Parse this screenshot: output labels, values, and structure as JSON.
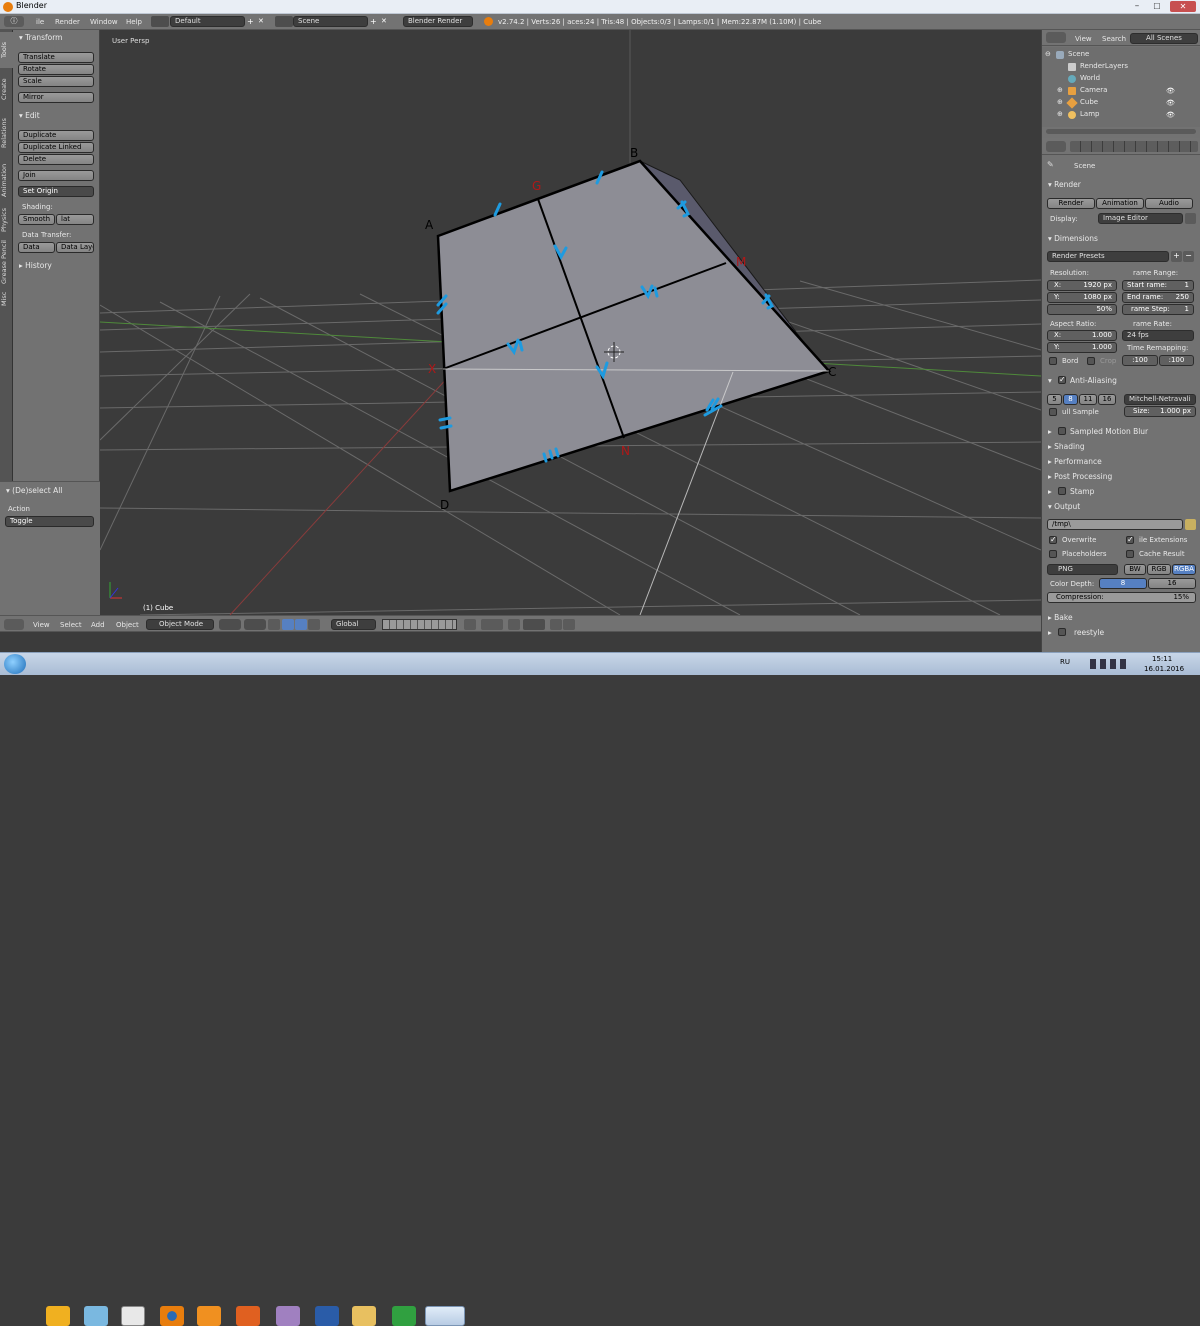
{
  "window": {
    "title": "Blender"
  },
  "top_menu": {
    "items": [
      "ile",
      "Render",
      "Window",
      "Help"
    ],
    "layout": "Default",
    "scene": "Scene",
    "engine": "Blender Render",
    "stats": "v2.74.2 | Verts:26 | aces:24 | Tris:48 | Objects:0/3 | Lamps:0/1 | Mem:22.87M (1.10M) | Cube"
  },
  "left_tabs": [
    "Tools",
    "Create",
    "Relations",
    "Animation",
    "Physics",
    "Grease Pencil",
    "Misc"
  ],
  "tools": {
    "transform_title": "Transform",
    "translate": "Translate",
    "rotate": "Rotate",
    "scale": "Scale",
    "mirror": "Mirror",
    "edit_title": "Edit",
    "duplicate": "Duplicate",
    "duplicate_linked": "Duplicate Linked",
    "delete": "Delete",
    "join": "Join",
    "set_origin": "Set Origin",
    "shading_label": "Shading:",
    "smooth": "Smooth",
    "flat": "lat",
    "data_transfer_label": "Data Transfer:",
    "data": "Data",
    "data_layo": "Data Layo",
    "history_title": "History"
  },
  "operator": {
    "title": "(De)select All",
    "action_label": "Action",
    "action_value": "Toggle"
  },
  "viewport": {
    "view_name": "User Persp",
    "object_label": "(1) Cube",
    "points": [
      "A",
      "B",
      "C",
      "D",
      "G",
      "M",
      "N",
      "X"
    ],
    "marks": [
      "I",
      "I",
      "II",
      "II",
      "II",
      "III",
      "IV",
      "IV",
      "V",
      "V",
      "VI",
      "VI"
    ]
  },
  "bottom_bar": {
    "view": "View",
    "select": "Select",
    "add": "Add",
    "object": "Object",
    "mode": "Object Mode",
    "orientation": "Global"
  },
  "outliner": {
    "tabs": [
      "View",
      "Search",
      "All Scenes"
    ],
    "items": [
      "Scene",
      "RenderLayers",
      "World",
      "Camera",
      "Cube",
      "Lamp"
    ]
  },
  "properties": {
    "scene_label": "Scene",
    "render_title": "Render",
    "render_btn": "Render",
    "animation_btn": "Animation",
    "audio_btn": "Audio",
    "display_label": "Display:",
    "display_value": "Image Editor",
    "dimensions_title": "Dimensions",
    "render_presets": "Render Presets",
    "resolution_label": "Resolution:",
    "res_x": "X:",
    "res_x_val": "1920 px",
    "res_y": "Y:",
    "res_y_val": "1080 px",
    "res_pct": "50%",
    "frame_range_label": "rame Range:",
    "start_label": "Start",
    "start_field": "rame:",
    "start_val": "1",
    "end_label": "End",
    "end_field": "rame:",
    "end_val": "250",
    "step_field": "rame Step:",
    "step_val": "1",
    "aspect_label": "Aspect Ratio:",
    "asp_x": "X:",
    "asp_x_val": "1.000",
    "asp_y": "Y:",
    "asp_y_val": "1.000",
    "frame_rate_label": "rame Rate:",
    "fps": "24 fps",
    "time_remap_label": "Time Remapping:",
    "remap_old": ":100",
    "remap_new": ":100",
    "border": "Bord",
    "crop": "Crop",
    "aa_title": "Anti-Aliasing",
    "aa_5": "5",
    "aa_8": "8",
    "aa_11": "11",
    "aa_16": "16",
    "aa_filter": "Mitchell-Netravali",
    "full_sample": "ull Sample",
    "size_label": "Size:",
    "size_val": "1.000 px",
    "motion_blur": "Sampled Motion Blur",
    "shading": "Shading",
    "performance": "Performance",
    "post_processing": "Post Processing",
    "stamp": "Stamp",
    "output_title": "Output",
    "output_path": "/tmp\\",
    "overwrite": "Overwrite",
    "file_ext": "ile Extensions",
    "placeholders": "Placeholders",
    "cache_result": "Cache Result",
    "format": "PNG",
    "bw": "BW",
    "rgb": "RGB",
    "rgba": "RGBA",
    "color_depth_label": "Color Depth:",
    "depth_8": "8",
    "depth_16": "16",
    "compression_label": "Compression:",
    "compression_val": "15%",
    "bake": "Bake",
    "freestyle": "reestyle"
  },
  "taskbar": {
    "lang": "RU",
    "time": "15:11",
    "date": "16.01.2016"
  },
  "colors": {
    "annotation_blue": "#1e9be0",
    "annotation_red": "#b01818",
    "face_gray": "#8e8e96",
    "accent_blue": "#5680c2"
  }
}
